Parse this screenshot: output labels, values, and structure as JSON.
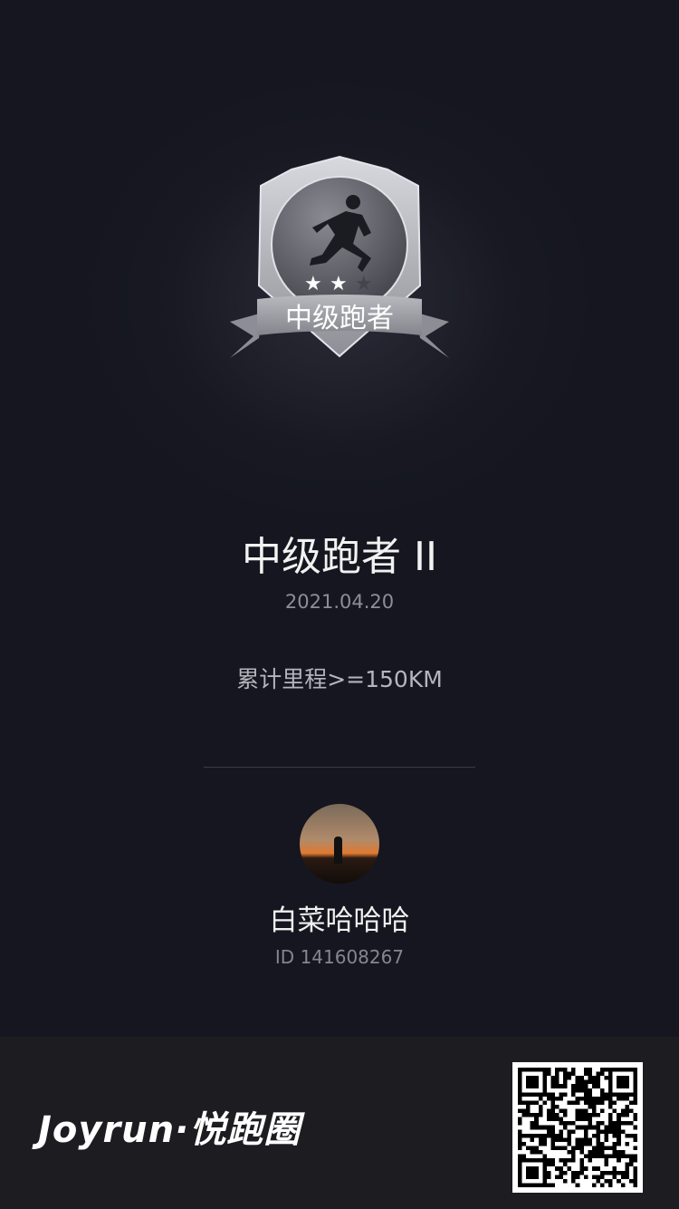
{
  "badge": {
    "ribbon_text": "中级跑者",
    "stars_earned": 2,
    "stars_total": 3,
    "colors": {
      "shield": "#a9aab0",
      "ribbon": "#9c9da4"
    }
  },
  "medal": {
    "title": "中级跑者 II",
    "date": "2021.04.20",
    "requirement": "累计里程>=150KM"
  },
  "user": {
    "name": "白菜哈哈哈",
    "id": "ID 141608267"
  },
  "footer": {
    "logo": "Joyrun·悦跑圈"
  }
}
